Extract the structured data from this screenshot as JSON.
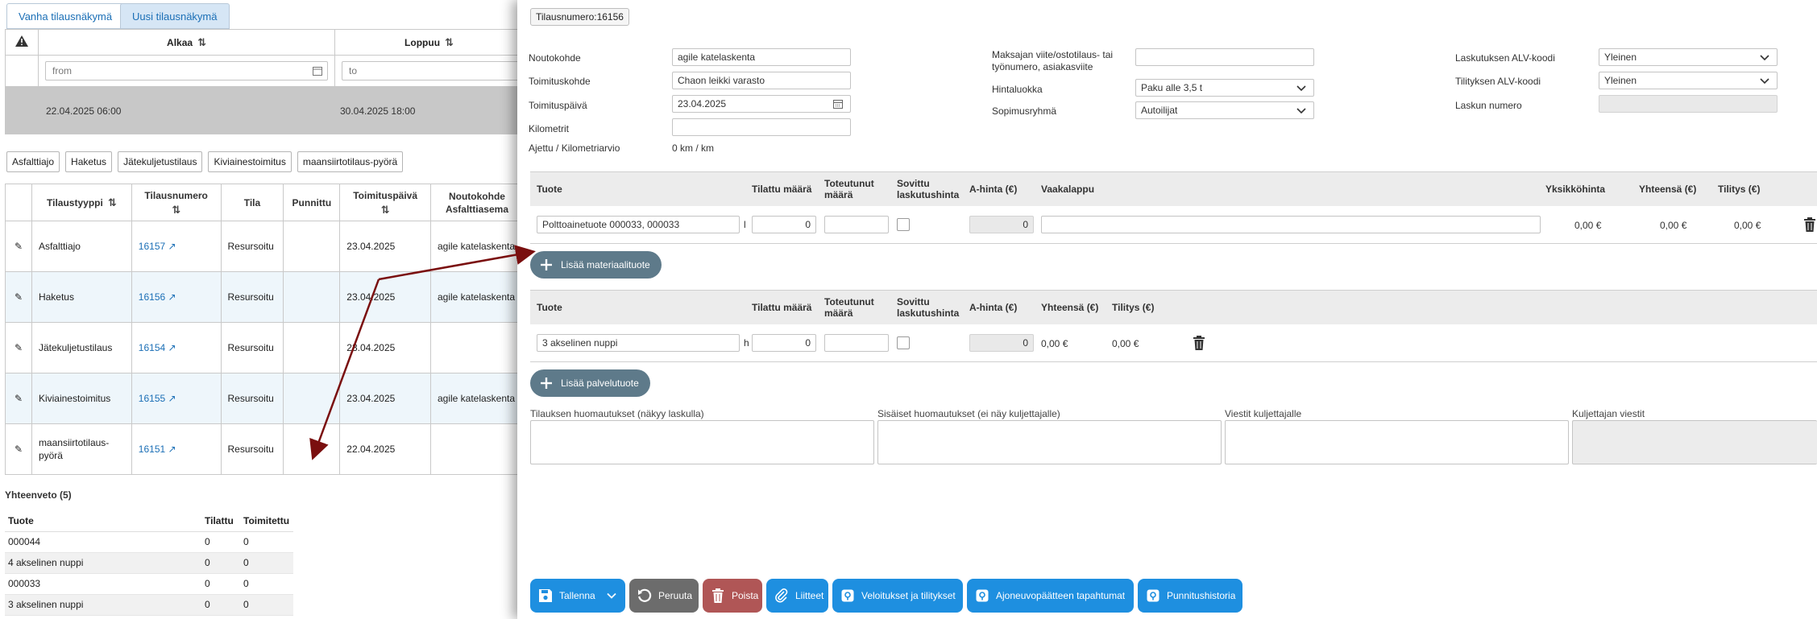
{
  "tabs": {
    "old": "Vanha tilausnäkymä",
    "new": "Uusi tilausnäkymä"
  },
  "dates": {
    "col_start": "Alkaa",
    "col_end": "Loppuu",
    "from_placeholder": "from",
    "to_placeholder": "to",
    "start_value": "22.04.2025 06:00",
    "end_value": "30.04.2025 18:00"
  },
  "type_buttons": [
    "Asfalttiajo",
    "Haketus",
    "Jätekuljetustilaus",
    "Kiviainestoimitus",
    "maansiirtotilaus-pyörä"
  ],
  "orders": {
    "headers": [
      "Tilaustyyppi",
      "Tilausnumero",
      "Tila",
      "Punnittu",
      "Toimituspäivä",
      "Noutokohde Asfalttiasema"
    ],
    "rows": [
      {
        "type": "Asfalttiajo",
        "number": "16157",
        "status": "Resursoitu",
        "weighed": "",
        "date": "23.04.2025",
        "pickup": "agile katelaskenta"
      },
      {
        "type": "Haketus",
        "number": "16156",
        "status": "Resursoitu",
        "weighed": "",
        "date": "23.04.2025",
        "pickup": "agile katelaskenta"
      },
      {
        "type": "Jätekuljetustilaus",
        "number": "16154",
        "status": "Resursoitu",
        "weighed": "",
        "date": "23.04.2025",
        "pickup": ""
      },
      {
        "type": "Kiviainestoimitus",
        "number": "16155",
        "status": "Resursoitu",
        "weighed": "",
        "date": "23.04.2025",
        "pickup": "agile katelaskenta"
      },
      {
        "type": "maansiirtotilaus-pyörä",
        "number": "16151",
        "status": "Resursoitu",
        "weighed": "",
        "date": "22.04.2025",
        "pickup": ""
      }
    ]
  },
  "summary": {
    "title": "Yhteenveto (5)",
    "headers": [
      "Tuote",
      "Tilattu",
      "Toimitettu"
    ],
    "rows": [
      [
        "000044",
        "0",
        "0"
      ],
      [
        "4 akselinen nuppi",
        "0",
        "0"
      ],
      [
        "000033",
        "0",
        "0"
      ],
      [
        "3 akselinen nuppi",
        "0",
        "0"
      ]
    ]
  },
  "panel": {
    "order_badge": "Tilausnumero:16156",
    "left_fields": {
      "pickup_label": "Noutokohde",
      "pickup_value": "agile katelaskenta",
      "delivery_label": "Toimituskohde",
      "delivery_value": "Chaon leikki varasto",
      "date_label": "Toimituspäivä",
      "date_value": "23.04.2025",
      "km_label": "Kilometrit",
      "km_value": "",
      "driven_label": "Ajettu / Kilometriarvio",
      "driven_value": "0 km / km"
    },
    "mid_fields": {
      "ref_label_1": "Maksajan viite/ostotilaus- tai",
      "ref_label_2": "työnumero, asiakasviite",
      "ref_value": "",
      "price_label": "Hintaluokka",
      "price_value": "Paku alle 3,5 t",
      "contract_label": "Sopimusryhmä",
      "contract_value": "Autoilijat"
    },
    "right_fields": {
      "vat_invoice_label": "Laskutuksen ALV-koodi",
      "vat_invoice_value": "Yleinen",
      "vat_settle_label": "Tilityksen ALV-koodi",
      "vat_settle_value": "Yleinen",
      "invoice_no_label": "Laskun numero",
      "invoice_no_value": ""
    },
    "material": {
      "headers": {
        "product": "Tuote",
        "ordered": "Tilattu määrä",
        "realized_1": "Toteutunut",
        "realized_2": "määrä",
        "agreed_1": "Sovittu",
        "agreed_2": "laskutushinta",
        "unit_price": "A-hinta (€)",
        "scale_note": "Vaakalappu",
        "unit_value": "Yksikköhinta",
        "total": "Yhteensä (€)",
        "settlement": "Tilitys (€)"
      },
      "row": {
        "product": "Polttoainetuote 000033, 000033",
        "unit": "l",
        "ordered": "0",
        "realized": "",
        "price": "0",
        "scale_note": "",
        "unit_value": "0,00 €",
        "total": "0,00 €",
        "settlement": "0,00 €"
      },
      "add_label": "Lisää materiaalituote"
    },
    "service": {
      "headers": {
        "product": "Tuote",
        "ordered": "Tilattu määrä",
        "realized_1": "Toteutunut",
        "realized_2": "määrä",
        "agreed_1": "Sovittu",
        "agreed_2": "laskutushinta",
        "unit_price": "A-hinta (€)",
        "total": "Yhteensä (€)",
        "settlement": "Tilitys (€)"
      },
      "row": {
        "product": "3 akselinen nuppi",
        "unit": "h",
        "ordered": "0",
        "realized": "",
        "price": "0",
        "total": "0,00 €",
        "settlement": "0,00 €"
      },
      "add_label": "Lisää palvelutuote"
    },
    "notes": {
      "order_notes": "Tilauksen huomautukset (näkyy laskulla)",
      "internal_notes": "Sisäiset huomautukset (ei näy kuljettajalle)",
      "driver_messages": "Viestit kuljettajalle",
      "from_driver": "Kuljettajan viestit"
    },
    "actions": {
      "save": "Tallenna",
      "cancel": "Peruuta",
      "delete": "Poista",
      "attachments": "Liitteet",
      "charges": "Veloitukset ja tilitykset",
      "terminal_events": "Ajoneuvopäätteen tapahtumat",
      "weigh_history": "Punnitushistoria"
    }
  },
  "colors": {
    "primary": "#1e8fe0",
    "secondary": "#5e7a8a",
    "danger": "#b05656",
    "arrow": "#7a0f0f"
  }
}
